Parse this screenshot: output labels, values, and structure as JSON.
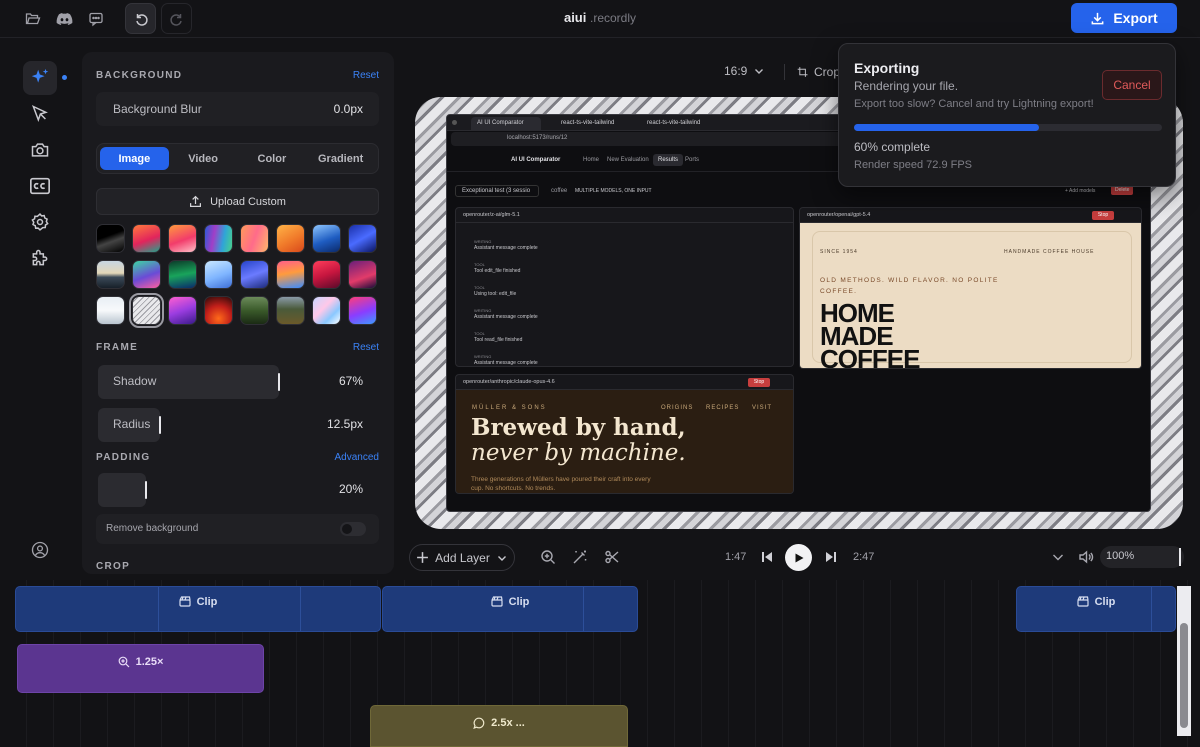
{
  "app": {
    "name": "aiui",
    "suffix": ".recordly"
  },
  "toolbar": {
    "export_label": "Export"
  },
  "panel": {
    "background": {
      "title": "BACKGROUND",
      "reset": "Reset",
      "blur_label": "Background Blur",
      "blur_value": "0.0px",
      "tabs": [
        "Image",
        "Video",
        "Color",
        "Gradient"
      ],
      "active_tab": "Image",
      "upload_label": "Upload Custom"
    },
    "frame": {
      "title": "FRAME",
      "reset": "Reset",
      "shadow_label": "Shadow",
      "shadow_value": "67%",
      "shadow_level": 0.67,
      "radius_label": "Radius",
      "radius_value": "12.5px"
    },
    "padding": {
      "title": "PADDING",
      "advanced": "Advanced",
      "value": "20%",
      "remove_bg_label": "Remove background"
    },
    "crop": {
      "title": "CROP"
    }
  },
  "canvas": {
    "aspect": "16:9",
    "crop_label": "Crop"
  },
  "export_popup": {
    "title": "Exporting",
    "subtitle": "Rendering your file.",
    "note": "Export too slow? Cancel and try Lightning export!",
    "cancel_label": "Cancel",
    "progress": 0.6,
    "progress_text": "60% complete",
    "fps_text": "Render speed 72.9 FPS"
  },
  "transport": {
    "add_layer": "Add Layer",
    "current_time": "1:47",
    "total_time": "2:47",
    "zoom": "100%"
  },
  "timeline": {
    "clips": [
      {
        "label": "Clip"
      },
      {
        "label": "Clip"
      },
      {
        "label": "Clip"
      }
    ],
    "zoom_label": "1.25×",
    "speed_label": "2.5x ..."
  },
  "screenshot": {
    "tabs": [
      "AI UI Comparator",
      "react-ts-vite-tailwind",
      "react-ts-vite-tailwind"
    ],
    "url": "localhost:5173/runs/12",
    "app_title": "AI UI Comparator",
    "nav": [
      "Home",
      "New Evaluation",
      "Results",
      "Ports"
    ],
    "active_nav": "Results",
    "test_name": "Exceptional test (3 sessio",
    "test_tag": "coffee",
    "test_mode": "MULTIPLE MODELS, ONE INPUT",
    "add_models": "+ Add models",
    "delete_label": "Delete",
    "pane1_title": "openrouter/z-ai/glm-5.1",
    "pane2_title": "openrouter/openai/gpt-5.4",
    "pane3_title": "openrouter/anthropic/claude-opus-4.6",
    "stop": "Stop",
    "log": [
      {
        "kind": "WRITING",
        "text": "Assistant message complete"
      },
      {
        "kind": "TOOL",
        "text": "Tool edit_file finished"
      },
      {
        "kind": "TOOL",
        "text": "Using tool: edit_file"
      },
      {
        "kind": "WRITING",
        "text": "Assistant message complete"
      },
      {
        "kind": "TOOL",
        "text": "Tool read_file finished"
      },
      {
        "kind": "WRITING",
        "text": "Assistant message complete"
      }
    ],
    "home_since": "SINCE 1954",
    "home_brand": "HANDMADE COFFEE HOUSE",
    "home_tag": "OLD METHODS. WILD FLAVOR. NO POLITE COFFEE.",
    "home_head1": "HOME",
    "home_head2": "MADE",
    "home_head3": "COFFEE",
    "hand_brand": "MÜLLER & SONS",
    "hand_nav": [
      "ORIGINS",
      "RECIPES",
      "VISIT"
    ],
    "hand_head1": "Brewed by hand,",
    "hand_head2": "never by machine.",
    "hand_body": "Three generations of Müllers have poured their craft into every cup. No shortcuts. No trends."
  },
  "colors": {
    "accent": "#2563eb",
    "clip": "#1e3a7a",
    "zoom": "#5b3590",
    "speed": "#5b5430",
    "danger": "#e05a5a"
  }
}
